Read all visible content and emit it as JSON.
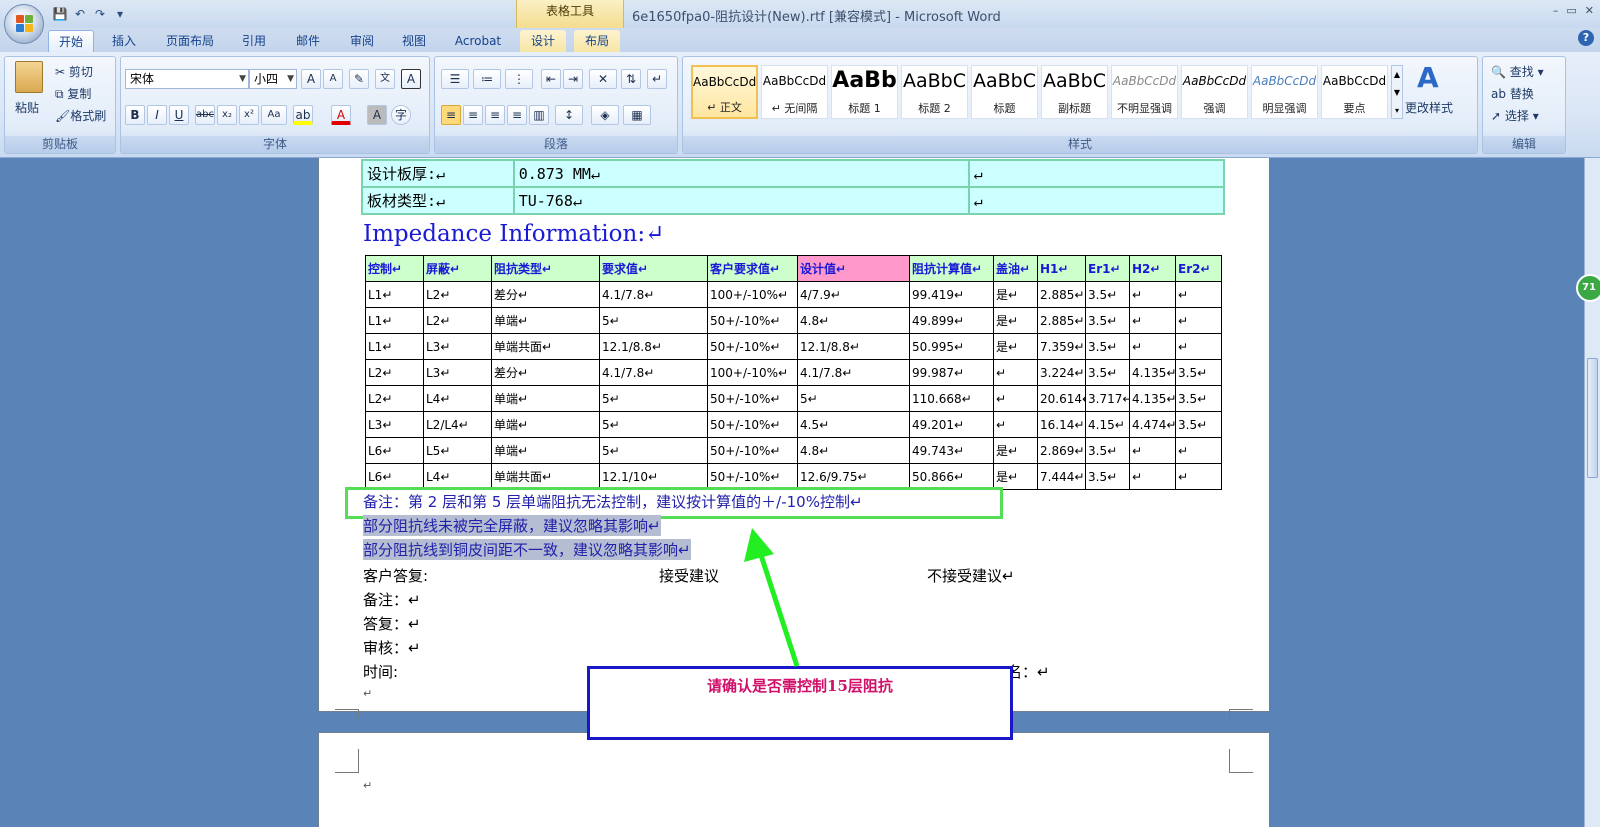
{
  "window": {
    "title": "6e1650fpa0-阻抗设计(New).rtf [兼容模式] - Microsoft Word",
    "context_tab_group": "表格工具",
    "controls": [
      "–",
      "▭",
      "✕"
    ]
  },
  "quick_access": [
    "save",
    "undo",
    "redo",
    "customize"
  ],
  "tabs": [
    {
      "label": "开始",
      "active": true
    },
    {
      "label": "插入"
    },
    {
      "label": "页面布局"
    },
    {
      "label": "引用"
    },
    {
      "label": "邮件"
    },
    {
      "label": "审阅"
    },
    {
      "label": "视图"
    },
    {
      "label": "Acrobat"
    },
    {
      "label": "设计",
      "context": true
    },
    {
      "label": "布局",
      "context": true
    }
  ],
  "ribbon": {
    "clipboard": {
      "label": "剪贴板",
      "paste": "粘贴",
      "cut": "剪切",
      "copy": "复制",
      "format_painter": "格式刷"
    },
    "font": {
      "label": "字体",
      "font_name": "宋体",
      "font_size": "小四"
    },
    "paragraph": {
      "label": "段落"
    },
    "styles": {
      "label": "样式",
      "change_styles": "更改样式",
      "items": [
        {
          "sample": "AaBbCcDd",
          "name": "↵ 正文",
          "selected": true
        },
        {
          "sample": "AaBbCcDd",
          "name": "↵ 无间隔"
        },
        {
          "sample": "AaBb",
          "name": "标题 1"
        },
        {
          "sample": "AaBbC",
          "name": "标题 2"
        },
        {
          "sample": "AaBbC",
          "name": "标题"
        },
        {
          "sample": "AaBbC",
          "name": "副标题"
        },
        {
          "sample": "AaBbCcDd",
          "name": "不明显强调"
        },
        {
          "sample": "AaBbCcDd",
          "name": "强调"
        },
        {
          "sample": "AaBbCcDd",
          "name": "明显强调"
        },
        {
          "sample": "AaBbCcDd",
          "name": "要点"
        }
      ]
    },
    "editing": {
      "label": "编辑",
      "find": "查找",
      "replace": "替换",
      "select": "选择"
    }
  },
  "document": {
    "info_rows": [
      {
        "label": "设计板厚:↵",
        "value": "0.873 MM↵",
        "extra": "↵"
      },
      {
        "label": "板材类型:↵",
        "value": "TU-768↵",
        "extra": "↵"
      }
    ],
    "impedance_title": "Impedance Information:↵",
    "impedance_headers": [
      "控制↵",
      "屏蔽↵",
      "阻抗类型↵",
      "要求值↵",
      "客户要求值↵",
      "设计值↵",
      "阻抗计算值↵",
      "盖油↵",
      "H1↵",
      "Er1↵",
      "H2↵",
      "Er2↵"
    ],
    "impedance_rows": [
      [
        "L1↵",
        "L2↵",
        "差分↵",
        "4.1/7.8↵",
        "100+/-10%↵",
        "4/7.9↵",
        "99.419↵",
        "是↵",
        "2.885↵",
        "3.5↵",
        "↵",
        "↵"
      ],
      [
        "L1↵",
        "L2↵",
        "单端↵",
        "5↵",
        "50+/-10%↵",
        "4.8↵",
        "49.899↵",
        "是↵",
        "2.885↵",
        "3.5↵",
        "↵",
        "↵"
      ],
      [
        "L1↵",
        "L3↵",
        "单端共面↵",
        "12.1/8.8↵",
        "50+/-10%↵",
        "12.1/8.8↵",
        "50.995↵",
        "是↵",
        "7.359↵",
        "3.5↵",
        "↵",
        "↵"
      ],
      [
        "L2↵",
        "L3↵",
        "差分↵",
        "4.1/7.8↵",
        "100+/-10%↵",
        "4.1/7.8↵",
        "99.987↵",
        "↵",
        "3.224↵",
        "3.5↵",
        "4.135↵",
        "3.5↵"
      ],
      [
        "L2↵",
        "L4↵",
        "单端↵",
        "5↵",
        "50+/-10%↵",
        "5↵",
        "110.668↵",
        "↵",
        "20.614↵",
        "3.717↵",
        "4.135↵",
        "3.5↵"
      ],
      [
        "L3↵",
        "L2/L4↵",
        "单端↵",
        "5↵",
        "50+/-10%↵",
        "4.5↵",
        "49.201↵",
        "↵",
        "16.14↵",
        "4.15↵",
        "4.474↵",
        "3.5↵"
      ],
      [
        "L6↵",
        "L5↵",
        "单端↵",
        "5↵",
        "50+/-10%↵",
        "4.8↵",
        "49.743↵",
        "是↵",
        "2.869↵",
        "3.5↵",
        "↵",
        "↵"
      ],
      [
        "L6↵",
        "L4↵",
        "单端共面↵",
        "12.1/10↵",
        "50+/-10%↵",
        "12.6/9.75↵",
        "50.866↵",
        "是↵",
        "7.444↵",
        "3.5↵",
        "↵",
        "↵"
      ]
    ],
    "notes": [
      "备注：第 2 层和第 5 层单端阻抗无法控制，建议按计算值的＋/-10%控制↵",
      "部分阻抗线未被完全屏蔽，建议忽略其影响↵",
      "部分阻抗线到铜皮间距不一致，建议忽略其影响↵"
    ],
    "customer_reply": {
      "label": "客户答复:",
      "accept": "接受建议",
      "reject": "不接受建议↵"
    },
    "footer_lines": [
      "备注：↵",
      "答复：↵",
      "审核：↵",
      "时间:"
    ],
    "sign_fragment": "名：↵",
    "paragraph_mark": "↵"
  },
  "annotation": {
    "callout_text": "请确认是否需控制15层阻抗",
    "arrow_color": "#22ee22",
    "box_color": "#1818c8",
    "text_color": "#d0106a"
  },
  "side_badge": "71"
}
